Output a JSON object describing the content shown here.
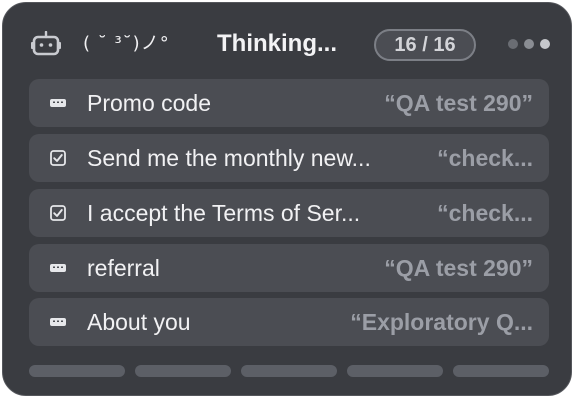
{
  "header": {
    "kaomoji": "( ˘ ³˘)ノ°",
    "title": "Thinking...",
    "counter": "16 / 16",
    "icon": "robot-icon"
  },
  "fields": [
    {
      "icon": "keyboard-icon",
      "label": "Promo code",
      "value": "“QA test 290”"
    },
    {
      "icon": "checkbox-icon",
      "label": "Send me the monthly new...",
      "value": "“check..."
    },
    {
      "icon": "checkbox-icon",
      "label": "I accept the Terms of Ser...",
      "value": "“check..."
    },
    {
      "icon": "keyboard-icon",
      "label": "referral",
      "value": "“QA test 290”"
    },
    {
      "icon": "keyboard-icon",
      "label": "About you",
      "value": "“Exploratory Q..."
    }
  ],
  "progress": {
    "segments_total": 5,
    "segments_complete": 5
  },
  "colors": {
    "panel": "#3a3c41",
    "row": "#4b4d53",
    "text": "#f1f1f3",
    "value_text": "#9b9ea6",
    "progress": "#5c5f66"
  }
}
